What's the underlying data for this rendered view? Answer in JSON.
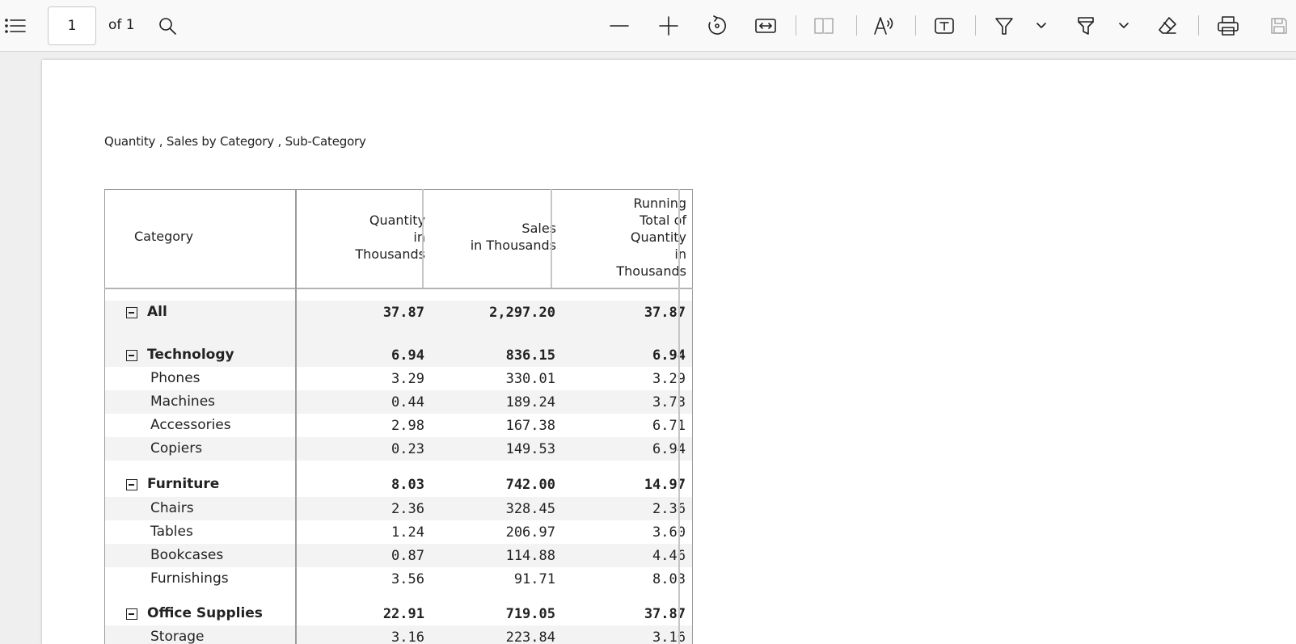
{
  "toolbar": {
    "page_number": "1",
    "page_of": "of 1",
    "icons": [
      "contents-icon",
      "search-icon",
      "zoom-out-icon",
      "zoom-in-icon",
      "rotate-icon",
      "fit-width-icon",
      "two-page-icon",
      "read-aloud-icon",
      "text-box-icon",
      "draw-icon",
      "highlight-icon",
      "eraser-icon",
      "print-icon",
      "save-icon"
    ]
  },
  "document": {
    "title": "Quantity , Sales by Category , Sub-Category",
    "headers": {
      "category": "Category",
      "quantity": [
        "Quantity",
        "in",
        "Thousands"
      ],
      "sales": [
        "Sales",
        "in Thousands"
      ],
      "running": [
        "Running",
        "Total of",
        "Quantity",
        "in",
        "Thousands"
      ]
    },
    "rows": [
      {
        "label": "All",
        "quantity": "37.87",
        "sales": "2,297.20",
        "running": "37.87",
        "group": true
      },
      {
        "label": "Technology",
        "quantity": "6.94",
        "sales": "836.15",
        "running": "6.94",
        "group": true
      },
      {
        "label": "Phones",
        "quantity": "3.29",
        "sales": "330.01",
        "running": "3.29"
      },
      {
        "label": "Machines",
        "quantity": "0.44",
        "sales": "189.24",
        "running": "3.73"
      },
      {
        "label": "Accessories",
        "quantity": "2.98",
        "sales": "167.38",
        "running": "6.71"
      },
      {
        "label": "Copiers",
        "quantity": "0.23",
        "sales": "149.53",
        "running": "6.94"
      },
      {
        "label": "Furniture",
        "quantity": "8.03",
        "sales": "742.00",
        "running": "14.97",
        "group": true
      },
      {
        "label": "Chairs",
        "quantity": "2.36",
        "sales": "328.45",
        "running": "2.36"
      },
      {
        "label": "Tables",
        "quantity": "1.24",
        "sales": "206.97",
        "running": "3.60"
      },
      {
        "label": "Bookcases",
        "quantity": "0.87",
        "sales": "114.88",
        "running": "4.46"
      },
      {
        "label": "Furnishings",
        "quantity": "3.56",
        "sales": "91.71",
        "running": "8.03"
      },
      {
        "label": "Office Supplies",
        "quantity": "22.91",
        "sales": "719.05",
        "running": "37.87",
        "group": true
      },
      {
        "label": "Storage",
        "quantity": "3.16",
        "sales": "223.84",
        "running": "3.16"
      }
    ]
  }
}
